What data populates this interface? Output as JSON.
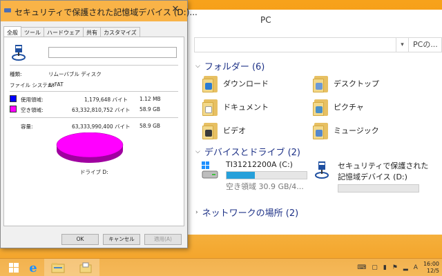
{
  "explorer": {
    "title": "PC",
    "search_placeholder": "PCの...",
    "folders_header": "フォルダー (6)",
    "folders": [
      {
        "label": "ダウンロード",
        "icon": "downloads-folder-icon",
        "overlay": "#2b7cd3"
      },
      {
        "label": "デスクトップ",
        "icon": "desktop-folder-icon",
        "overlay": "#6c9ad6"
      },
      {
        "label": "ドキュメント",
        "icon": "documents-folder-icon",
        "overlay": "#ffffff"
      },
      {
        "label": "ピクチャ",
        "icon": "pictures-folder-icon",
        "overlay": "#4a90c8"
      },
      {
        "label": "ビデオ",
        "icon": "videos-folder-icon",
        "overlay": "#3a3a3a"
      },
      {
        "label": "ミュージック",
        "icon": "music-folder-icon",
        "overlay": "#5588cc"
      }
    ],
    "devices_header": "デバイスとドライブ (2)",
    "drives": [
      {
        "name": "TI31212200A (C:)",
        "free_text": "空き領域 30.9 GB/4...",
        "used_fraction": 0.35
      },
      {
        "name_line1": "セキュリティで保護された",
        "name_line2": "記憶域デバイス (D:)",
        "used_fraction": 0.0
      }
    ],
    "network_header": "ネットワークの場所 (2)"
  },
  "dialog": {
    "title": "セキュリティで保護された記憶域デバイス (D:)...",
    "close_label": "✕",
    "tabs": [
      "全般",
      "ツール",
      "ハードウェア",
      "共有",
      "カスタマイズ"
    ],
    "name_value": "",
    "type_label": "種類:",
    "type_value": "リムーバブル ディスク",
    "fs_label": "ファイル システム:",
    "fs_value": "exFAT",
    "used_label": "使用領域:",
    "used_bytes": "1,179,648 バイト",
    "used_size": "1.12 MB",
    "free_label": "空き領域:",
    "free_bytes": "63,332,810,752 バイト",
    "free_size": "58.9 GB",
    "capacity_label": "容量:",
    "capacity_bytes": "63,333,990,400 バイト",
    "capacity_size": "58.9 GB",
    "drive_label": "ドライブ D:",
    "used_color": "#0000ff",
    "free_color": "#ff00ff",
    "buttons": {
      "ok": "OK",
      "cancel": "キャンセル",
      "apply": "適用(A)"
    }
  },
  "taskbar": {
    "time": "16:00",
    "date": "12/5",
    "ime": "A"
  }
}
